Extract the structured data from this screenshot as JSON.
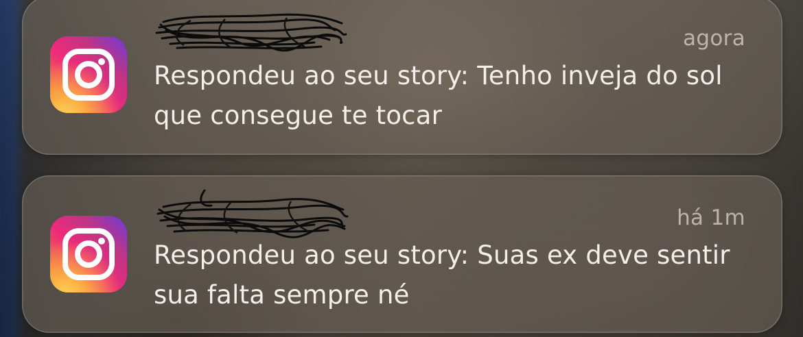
{
  "notifications": [
    {
      "app_icon": "instagram-icon",
      "sender": "",
      "timestamp": "agora",
      "message": "Respondeu ao seu story: Tenho inveja do sol que consegue te tocar"
    },
    {
      "app_icon": "instagram-icon",
      "sender": "",
      "timestamp": "há 1m",
      "message": "Respondeu ao seu story: Suas ex deve sentir sua falta sempre né"
    }
  ],
  "colors": {
    "instagram_gradient": [
      "#fdd65a",
      "#f58529",
      "#ee2a7b",
      "#c13584",
      "#6a3bd8"
    ],
    "message_text": "#f4efea",
    "timestamp_text": "#d8cdc2"
  }
}
